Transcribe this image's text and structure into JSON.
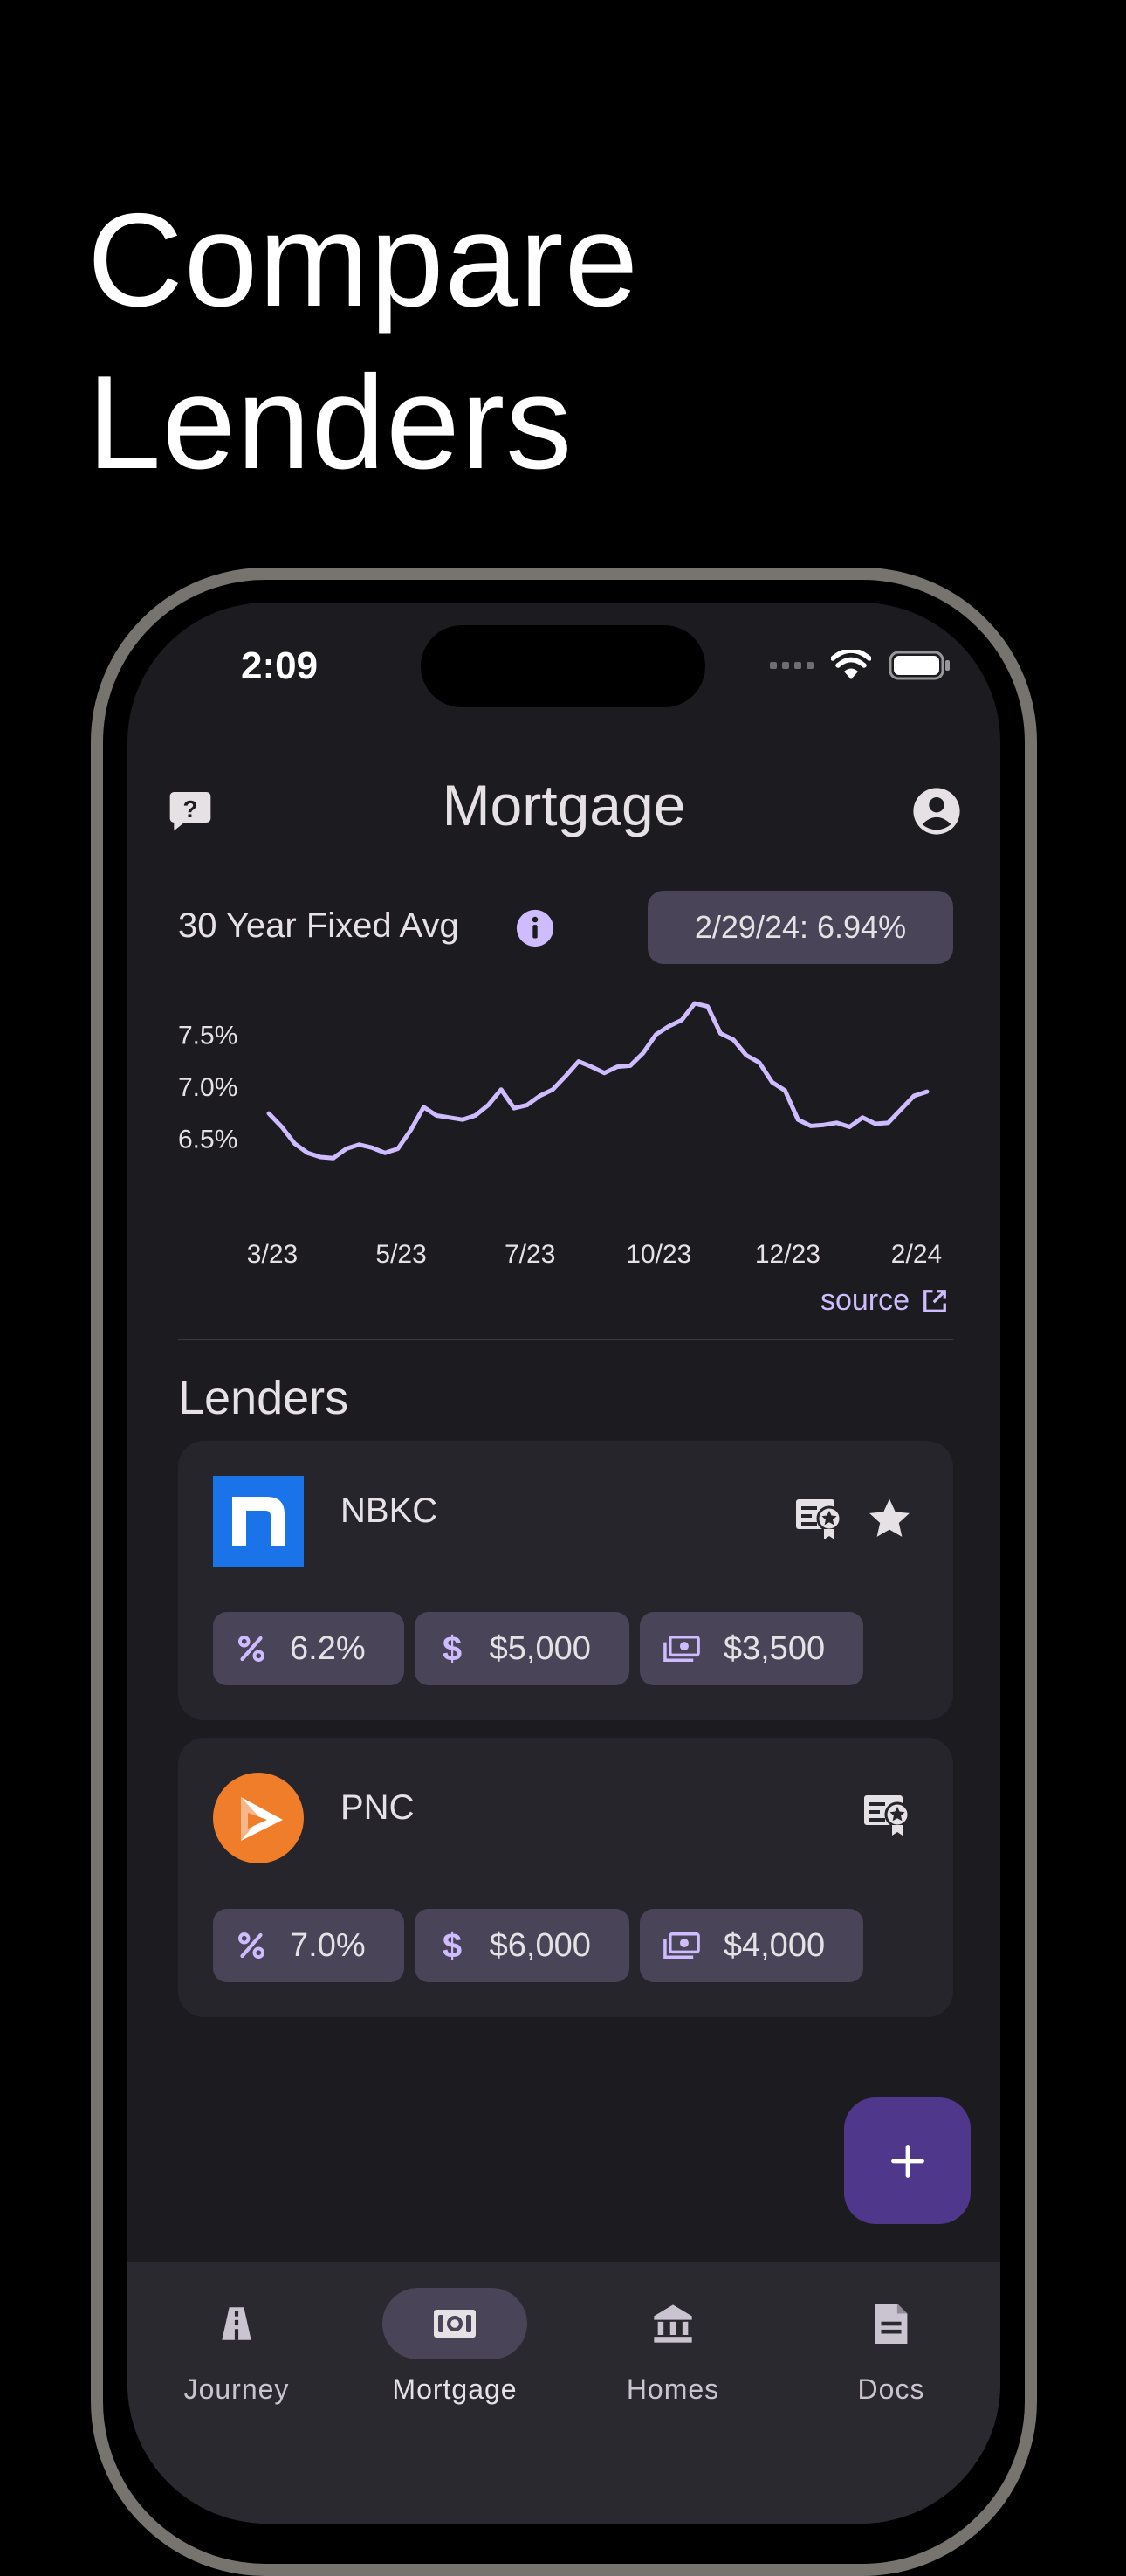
{
  "headline": {
    "line1": "Compare",
    "line2": "Lenders"
  },
  "status_bar": {
    "time": "2:09"
  },
  "header": {
    "title": "Mortgage",
    "help_icon": "help-chat-icon",
    "account_icon": "account-circle-icon"
  },
  "rate_summary": {
    "label": "30 Year Fixed Avg",
    "current": "2/29/24: 6.94%"
  },
  "chart_data": {
    "type": "line",
    "x_tick_labels": [
      "3/23",
      "5/23",
      "7/23",
      "10/23",
      "12/23",
      "2/24"
    ],
    "y_tick_labels": [
      "7.5%",
      "7.0%",
      "6.5%"
    ],
    "ylim": [
      6.1,
      7.95
    ],
    "grid": false,
    "line_color": "#cfbcff",
    "series": [
      {
        "values": [
          6.73,
          6.6,
          6.44,
          6.35,
          6.31,
          6.3,
          6.39,
          6.43,
          6.4,
          6.35,
          6.39,
          6.57,
          6.79,
          6.71,
          6.69,
          6.67,
          6.71,
          6.81,
          6.96,
          6.78,
          6.81,
          6.9,
          6.96,
          7.09,
          7.23,
          7.18,
          7.12,
          7.18,
          7.19,
          7.31,
          7.49,
          7.57,
          7.63,
          7.79,
          7.76,
          7.5,
          7.44,
          7.29,
          7.22,
          7.03,
          6.95,
          6.67,
          6.61,
          6.62,
          6.64,
          6.6,
          6.69,
          6.63,
          6.64,
          6.77,
          6.9,
          6.94
        ]
      }
    ]
  },
  "source": {
    "label": "source"
  },
  "lenders_section": {
    "title": "Lenders"
  },
  "lenders": [
    {
      "name": "NBKC",
      "logo_letter": "n",
      "logo_color": "#1a73e8",
      "rate": "6.2%",
      "closing_cost": "$5,000",
      "cash": "$3,500",
      "favorite": true
    },
    {
      "name": "PNC",
      "logo_color": "#ef7d2a",
      "rate": "7.0%",
      "closing_cost": "$6,000",
      "cash": "$4,000",
      "favorite": false
    }
  ],
  "fab": {
    "label": "+"
  },
  "nav": [
    {
      "label": "Journey",
      "icon": "road-icon"
    },
    {
      "label": "Mortgage",
      "icon": "cash-icon",
      "active": true
    },
    {
      "label": "Homes",
      "icon": "bank-icon"
    },
    {
      "label": "Docs",
      "icon": "document-icon"
    }
  ]
}
